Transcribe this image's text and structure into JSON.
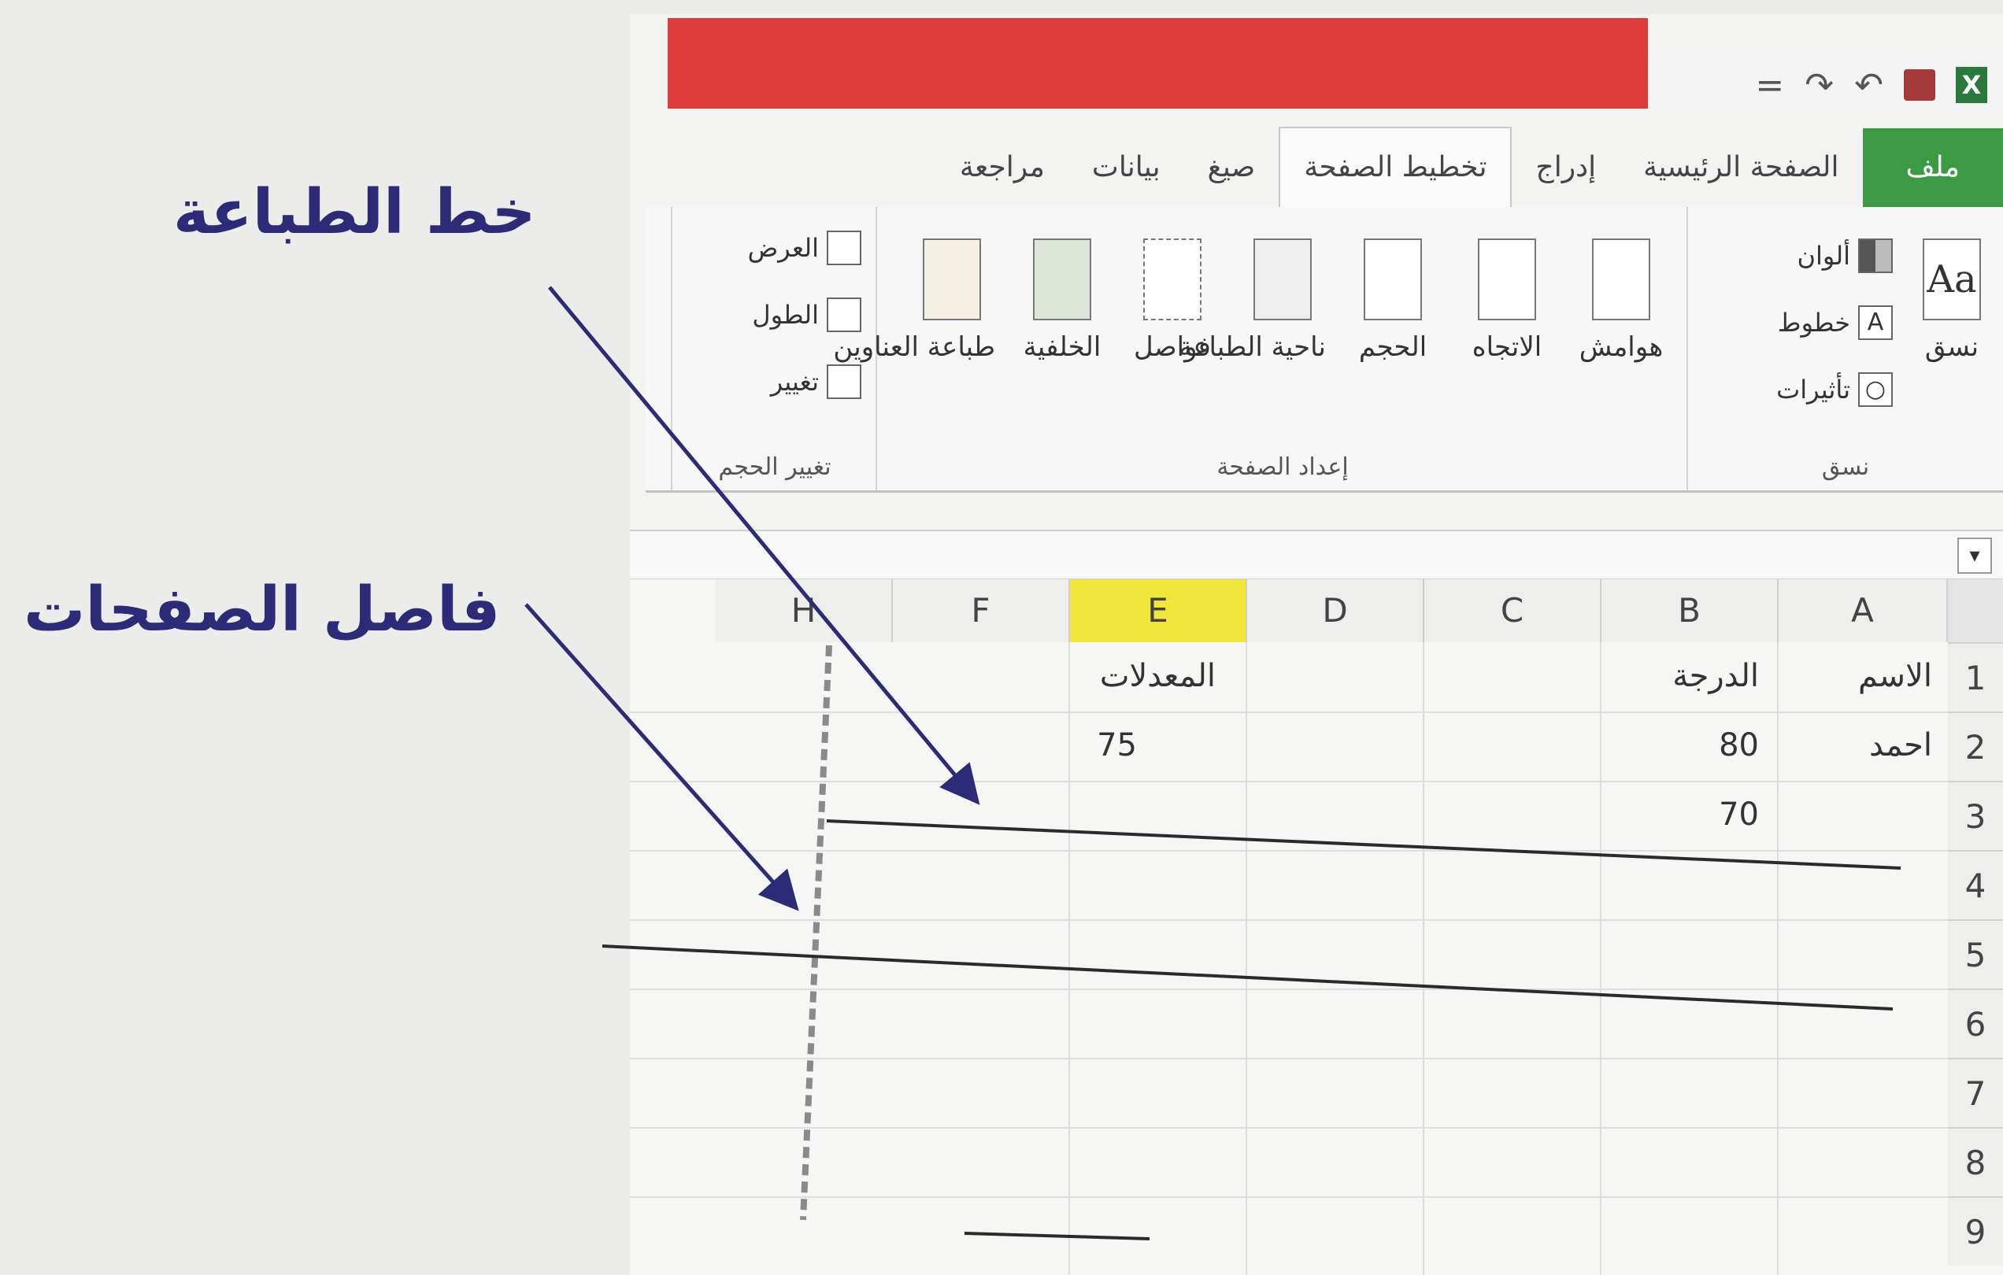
{
  "annotations": {
    "print_line": "خط الطباعة",
    "page_break": "فاصل الصفحات"
  },
  "tabs": [
    "ملف",
    "الصفحة الرئيسية",
    "إدراج",
    "تخطيط الصفحة",
    "صيغ",
    "بيانات",
    "مراجعة"
  ],
  "ribbon": {
    "themes_group": {
      "label": "نسق",
      "themes_button": "نسق",
      "colors": "ألوان",
      "fonts": "خطوط",
      "effects": "تأثيرات"
    },
    "page_setup_group": {
      "label": "إعداد الصفحة",
      "margins": "هوامش",
      "orientation": "الاتجاه",
      "size": "الحجم",
      "print_area": "ناحية الطباعة",
      "breaks": "فواصل",
      "background": "الخلفية",
      "print_titles": "طباعة العناوين"
    },
    "scale_group": {
      "label": "تغيير الحجم",
      "width": "العرض",
      "height": "الطول",
      "scale": "تغيير"
    }
  },
  "grid": {
    "columns": [
      "A",
      "B",
      "C",
      "D",
      "E",
      "F",
      "H"
    ],
    "selected_column": "E",
    "rows": [
      "1",
      "2",
      "3",
      "4",
      "5",
      "6",
      "7",
      "8",
      "9"
    ],
    "cells": {
      "A1": "الاسم",
      "B1": "الدرجة",
      "E1": "المعدلات",
      "A2": "احمد",
      "B2": "80",
      "E2": "75",
      "B3": "70"
    }
  },
  "colors": {
    "title_bar": "#dd3d3a",
    "file_tab": "#3d9a44",
    "selected_column": "#f1e63a",
    "annotation": "#2d2a78"
  }
}
